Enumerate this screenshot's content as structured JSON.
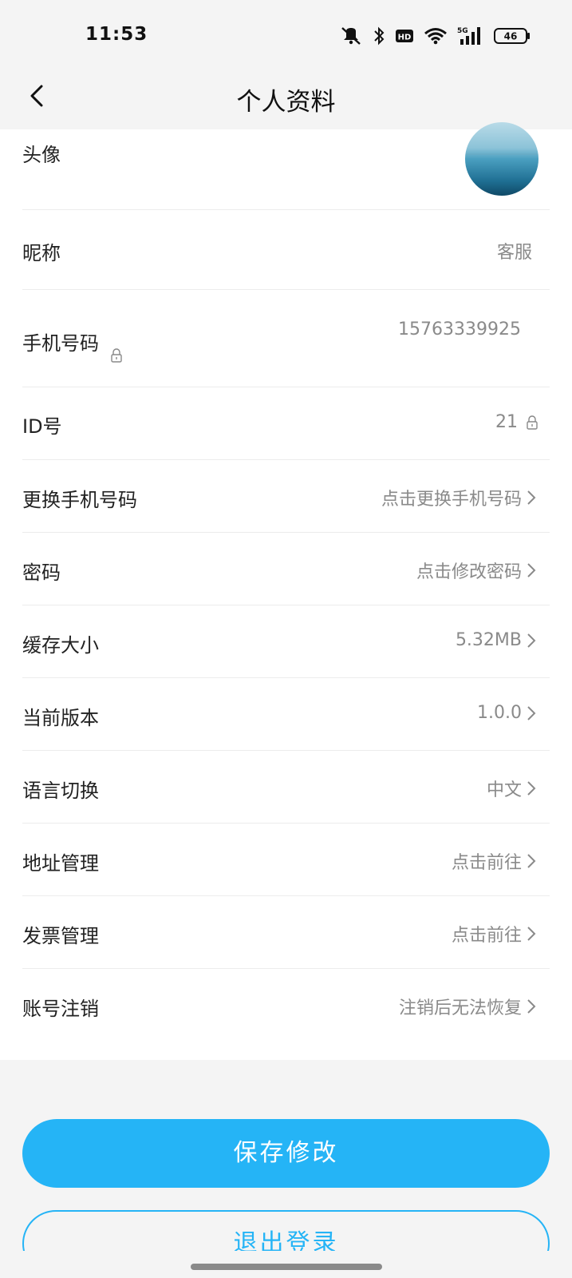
{
  "status_bar": {
    "time": "11:53",
    "network": "5G",
    "hd": "HD",
    "battery": "46",
    "icons": [
      "mute-icon",
      "bluetooth-icon",
      "hd-icon",
      "wifi-icon",
      "signal-icon",
      "battery-icon"
    ]
  },
  "nav": {
    "title": "个人资料",
    "back_icon": "back-arrow-icon"
  },
  "rows": {
    "avatar": {
      "label": "头像"
    },
    "nickname": {
      "label": "昵称",
      "value": "客服"
    },
    "phone": {
      "label": "手机号码",
      "value": "15763339925"
    },
    "id": {
      "label": "ID号",
      "value": "21"
    },
    "change_phone": {
      "label": "更换手机号码",
      "value": "点击更换手机号码"
    },
    "password": {
      "label": "密码",
      "value": "点击修改密码"
    },
    "cache": {
      "label": "缓存大小",
      "value": "5.32MB"
    },
    "version": {
      "label": "当前版本",
      "value": "1.0.0"
    },
    "language": {
      "label": "语言切换",
      "value": "中文"
    },
    "address": {
      "label": "地址管理",
      "value": "点击前往"
    },
    "invoice": {
      "label": "发票管理",
      "value": "点击前往"
    },
    "cancel_account": {
      "label": "账号注销",
      "value": "注销后无法恢复"
    }
  },
  "buttons": {
    "save": "保存修改",
    "logout": "退出登录"
  },
  "colors": {
    "accent": "#25b4f6",
    "background": "#f4f4f4",
    "panel": "#ffffff",
    "value_text": "#8a8a8a"
  }
}
